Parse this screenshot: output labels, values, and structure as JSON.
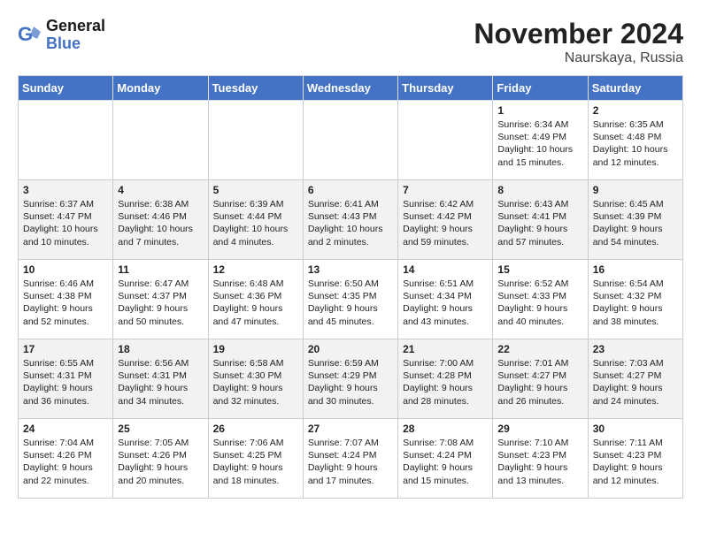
{
  "header": {
    "logo_line1": "General",
    "logo_line2": "Blue",
    "month": "November 2024",
    "location": "Naurskaya, Russia"
  },
  "days_of_week": [
    "Sunday",
    "Monday",
    "Tuesday",
    "Wednesday",
    "Thursday",
    "Friday",
    "Saturday"
  ],
  "weeks": [
    [
      {
        "day": "",
        "info": ""
      },
      {
        "day": "",
        "info": ""
      },
      {
        "day": "",
        "info": ""
      },
      {
        "day": "",
        "info": ""
      },
      {
        "day": "",
        "info": ""
      },
      {
        "day": "1",
        "info": "Sunrise: 6:34 AM\nSunset: 4:49 PM\nDaylight: 10 hours and 15 minutes."
      },
      {
        "day": "2",
        "info": "Sunrise: 6:35 AM\nSunset: 4:48 PM\nDaylight: 10 hours and 12 minutes."
      }
    ],
    [
      {
        "day": "3",
        "info": "Sunrise: 6:37 AM\nSunset: 4:47 PM\nDaylight: 10 hours and 10 minutes."
      },
      {
        "day": "4",
        "info": "Sunrise: 6:38 AM\nSunset: 4:46 PM\nDaylight: 10 hours and 7 minutes."
      },
      {
        "day": "5",
        "info": "Sunrise: 6:39 AM\nSunset: 4:44 PM\nDaylight: 10 hours and 4 minutes."
      },
      {
        "day": "6",
        "info": "Sunrise: 6:41 AM\nSunset: 4:43 PM\nDaylight: 10 hours and 2 minutes."
      },
      {
        "day": "7",
        "info": "Sunrise: 6:42 AM\nSunset: 4:42 PM\nDaylight: 9 hours and 59 minutes."
      },
      {
        "day": "8",
        "info": "Sunrise: 6:43 AM\nSunset: 4:41 PM\nDaylight: 9 hours and 57 minutes."
      },
      {
        "day": "9",
        "info": "Sunrise: 6:45 AM\nSunset: 4:39 PM\nDaylight: 9 hours and 54 minutes."
      }
    ],
    [
      {
        "day": "10",
        "info": "Sunrise: 6:46 AM\nSunset: 4:38 PM\nDaylight: 9 hours and 52 minutes."
      },
      {
        "day": "11",
        "info": "Sunrise: 6:47 AM\nSunset: 4:37 PM\nDaylight: 9 hours and 50 minutes."
      },
      {
        "day": "12",
        "info": "Sunrise: 6:48 AM\nSunset: 4:36 PM\nDaylight: 9 hours and 47 minutes."
      },
      {
        "day": "13",
        "info": "Sunrise: 6:50 AM\nSunset: 4:35 PM\nDaylight: 9 hours and 45 minutes."
      },
      {
        "day": "14",
        "info": "Sunrise: 6:51 AM\nSunset: 4:34 PM\nDaylight: 9 hours and 43 minutes."
      },
      {
        "day": "15",
        "info": "Sunrise: 6:52 AM\nSunset: 4:33 PM\nDaylight: 9 hours and 40 minutes."
      },
      {
        "day": "16",
        "info": "Sunrise: 6:54 AM\nSunset: 4:32 PM\nDaylight: 9 hours and 38 minutes."
      }
    ],
    [
      {
        "day": "17",
        "info": "Sunrise: 6:55 AM\nSunset: 4:31 PM\nDaylight: 9 hours and 36 minutes."
      },
      {
        "day": "18",
        "info": "Sunrise: 6:56 AM\nSunset: 4:31 PM\nDaylight: 9 hours and 34 minutes."
      },
      {
        "day": "19",
        "info": "Sunrise: 6:58 AM\nSunset: 4:30 PM\nDaylight: 9 hours and 32 minutes."
      },
      {
        "day": "20",
        "info": "Sunrise: 6:59 AM\nSunset: 4:29 PM\nDaylight: 9 hours and 30 minutes."
      },
      {
        "day": "21",
        "info": "Sunrise: 7:00 AM\nSunset: 4:28 PM\nDaylight: 9 hours and 28 minutes."
      },
      {
        "day": "22",
        "info": "Sunrise: 7:01 AM\nSunset: 4:27 PM\nDaylight: 9 hours and 26 minutes."
      },
      {
        "day": "23",
        "info": "Sunrise: 7:03 AM\nSunset: 4:27 PM\nDaylight: 9 hours and 24 minutes."
      }
    ],
    [
      {
        "day": "24",
        "info": "Sunrise: 7:04 AM\nSunset: 4:26 PM\nDaylight: 9 hours and 22 minutes."
      },
      {
        "day": "25",
        "info": "Sunrise: 7:05 AM\nSunset: 4:26 PM\nDaylight: 9 hours and 20 minutes."
      },
      {
        "day": "26",
        "info": "Sunrise: 7:06 AM\nSunset: 4:25 PM\nDaylight: 9 hours and 18 minutes."
      },
      {
        "day": "27",
        "info": "Sunrise: 7:07 AM\nSunset: 4:24 PM\nDaylight: 9 hours and 17 minutes."
      },
      {
        "day": "28",
        "info": "Sunrise: 7:08 AM\nSunset: 4:24 PM\nDaylight: 9 hours and 15 minutes."
      },
      {
        "day": "29",
        "info": "Sunrise: 7:10 AM\nSunset: 4:23 PM\nDaylight: 9 hours and 13 minutes."
      },
      {
        "day": "30",
        "info": "Sunrise: 7:11 AM\nSunset: 4:23 PM\nDaylight: 9 hours and 12 minutes."
      }
    ]
  ]
}
